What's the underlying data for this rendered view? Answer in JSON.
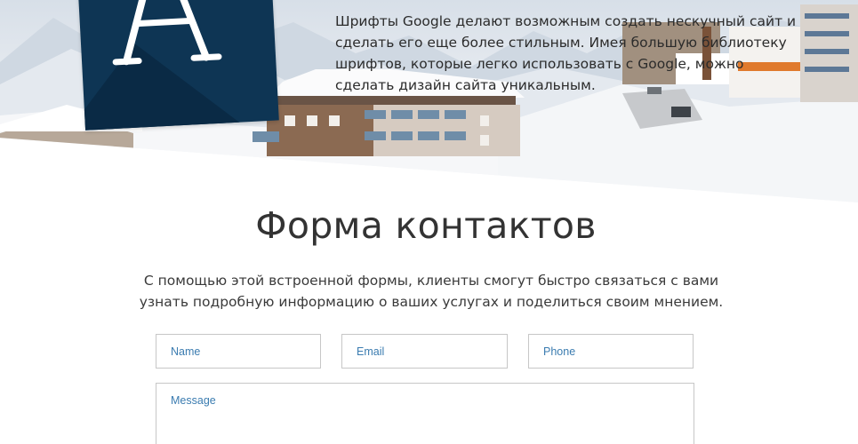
{
  "hero": {
    "logo_glyph": "A",
    "text": "Шрифты Google делают возможным создать нескучный сайт и сделать его еще более стильным. Имея большую библиотеку шрифтов, которые легко  использовать с Google, можно сделать дизайн сайта уникальным."
  },
  "contact": {
    "title": "Форма контактов",
    "description": "С помощью этой встроенной формы, клиенты смогут быстро связаться с вами узнать подробную информацию о ваших услугах и поделиться своим мнением.",
    "fields": {
      "name_placeholder": "Name",
      "email_placeholder": "Email",
      "phone_placeholder": "Phone",
      "message_placeholder": "Message"
    }
  },
  "colors": {
    "logo_bg": "#0e3554",
    "placeholder": "#3b7cb0",
    "title": "#333333"
  }
}
